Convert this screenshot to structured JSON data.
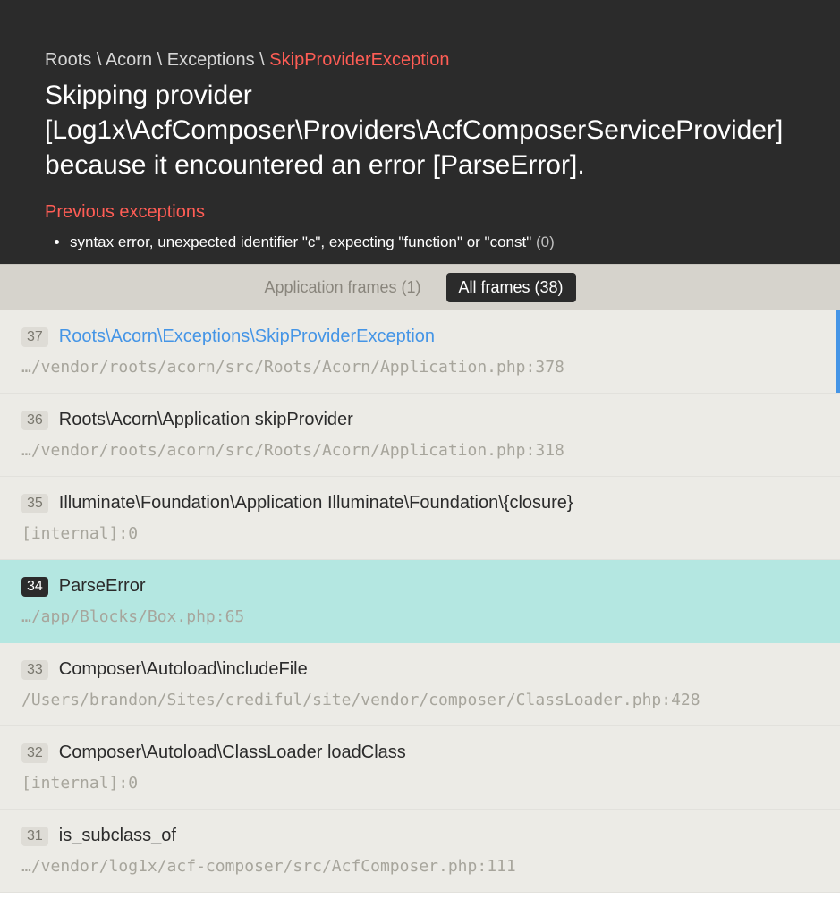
{
  "breadcrumb": {
    "parts": [
      "Roots",
      "Acorn",
      "Exceptions"
    ],
    "sep": " \\ ",
    "last": "SkipProviderException"
  },
  "title": "Skipping provider [Log1x\\AcfComposer\\Providers\\AcfComposerServiceProvider] because it encountered an error [ParseError].",
  "previous_exceptions_label": "Previous exceptions",
  "previous_exceptions": [
    {
      "text": "syntax error, unexpected identifier \"c\", expecting \"function\" or \"const\"",
      "code": "(0)"
    }
  ],
  "tabs": {
    "app": "Application frames (1)",
    "all": "All frames (38)"
  },
  "frames": [
    {
      "n": "37",
      "label": "Roots\\Acorn\\Exceptions\\SkipProviderException",
      "link": true,
      "path": "…/vendor/roots/acorn/src/Roots/Acorn/Application.php",
      "line": "378",
      "selected": true,
      "highlight": false,
      "dark": false
    },
    {
      "n": "36",
      "label": "Roots\\Acorn\\Application skipProvider",
      "link": false,
      "path": "…/vendor/roots/acorn/src/Roots/Acorn/Application.php",
      "line": "318",
      "selected": false,
      "highlight": false,
      "dark": false
    },
    {
      "n": "35",
      "label": "Illuminate\\Foundation\\Application Illuminate\\Foundation\\{closure}",
      "link": false,
      "path": "[internal]",
      "line": "0",
      "selected": false,
      "highlight": false,
      "dark": false
    },
    {
      "n": "34",
      "label": "ParseError",
      "link": false,
      "path": "…/app/Blocks/Box.php",
      "line": "65",
      "selected": false,
      "highlight": true,
      "dark": true
    },
    {
      "n": "33",
      "label": "Composer\\Autoload\\includeFile",
      "link": false,
      "path": "/Users/brandon/Sites/crediful/site/vendor/composer/ClassLoader.php",
      "line": "428",
      "selected": false,
      "highlight": false,
      "dark": false
    },
    {
      "n": "32",
      "label": "Composer\\Autoload\\ClassLoader loadClass",
      "link": false,
      "path": "[internal]",
      "line": "0",
      "selected": false,
      "highlight": false,
      "dark": false
    },
    {
      "n": "31",
      "label": "is_subclass_of",
      "link": false,
      "path": "…/vendor/log1x/acf-composer/src/AcfComposer.php",
      "line": "111",
      "selected": false,
      "highlight": false,
      "dark": false
    }
  ]
}
